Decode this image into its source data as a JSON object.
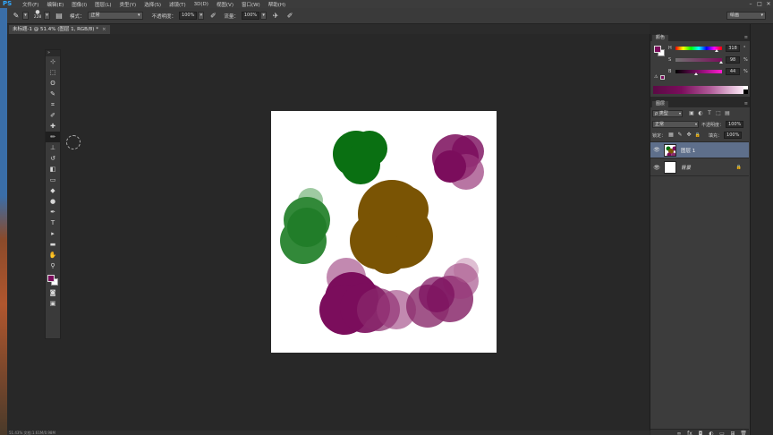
{
  "app": {
    "logo": "PS"
  },
  "menu": [
    "文件(F)",
    "编辑(E)",
    "图像(I)",
    "图层(L)",
    "类型(Y)",
    "选择(S)",
    "滤镜(T)",
    "3D(D)",
    "视图(V)",
    "窗口(W)",
    "帮助(H)"
  ],
  "window_controls": [
    "–",
    "□",
    "✕"
  ],
  "options": {
    "brush_size": "228",
    "mode_label": "模式：",
    "mode_value": "正常",
    "opacity_label": "不透明度：",
    "opacity_value": "100%",
    "flow_label": "流量：",
    "flow_value": "100%",
    "workspace": "绘画"
  },
  "document": {
    "tab_title": "未标题-1 @ 51.4% (图层 1, RGB/8) *",
    "close": "×",
    "status": "51.43%    文档:1.61M/0.98M"
  },
  "tools_panel": {
    "header": "»",
    "tools": [
      {
        "name": "move-tool",
        "glyph": "⊹"
      },
      {
        "name": "marquee-tool",
        "glyph": "⬚"
      },
      {
        "name": "lasso-tool",
        "glyph": "ʘ"
      },
      {
        "name": "quick-select-tool",
        "glyph": "✎"
      },
      {
        "name": "crop-tool",
        "glyph": "⌗"
      },
      {
        "name": "eyedropper-tool",
        "glyph": "✐"
      },
      {
        "name": "healing-brush-tool",
        "glyph": "✚"
      },
      {
        "name": "brush-tool",
        "glyph": "✏"
      },
      {
        "name": "clone-stamp-tool",
        "glyph": "⊥"
      },
      {
        "name": "history-brush-tool",
        "glyph": "↺"
      },
      {
        "name": "eraser-tool",
        "glyph": "◧"
      },
      {
        "name": "gradient-tool",
        "glyph": "▭"
      },
      {
        "name": "blur-tool",
        "glyph": "◆"
      },
      {
        "name": "dodge-tool",
        "glyph": "●"
      },
      {
        "name": "pen-tool",
        "glyph": "✒"
      },
      {
        "name": "type-tool",
        "glyph": "T"
      },
      {
        "name": "path-select-tool",
        "glyph": "▸"
      },
      {
        "name": "shape-tool",
        "glyph": "▬"
      },
      {
        "name": "hand-tool",
        "glyph": "✋"
      },
      {
        "name": "zoom-tool",
        "glyph": "⚲"
      }
    ],
    "quickmask": "◙",
    "screenmode": "▣"
  },
  "color_panel": {
    "tab": "颜色",
    "menu": "≡",
    "foreground": "#7b0d5c",
    "background": "#ffffff",
    "rows": [
      {
        "label": "H",
        "value": "318",
        "unit": "°",
        "level": 0.88
      },
      {
        "label": "S",
        "value": "98",
        "unit": "%",
        "level": 0.98
      },
      {
        "label": "B",
        "value": "44",
        "unit": "%",
        "level": 0.44
      }
    ]
  },
  "layers_panel": {
    "tab": "图层",
    "menu": "≡",
    "filter_kind": "ρ 类型",
    "filter_icons": [
      "▣",
      "◐",
      "T",
      "⬚",
      "▤"
    ],
    "blend_mode": "正常",
    "opacity_label": "不透明度：",
    "opacity_value": "100%",
    "lock_label": "锁定：",
    "lock_icons": [
      "▦",
      "✎",
      "✥",
      "🔒"
    ],
    "fill_label": "填充：",
    "fill_value": "100%",
    "layers": [
      {
        "name": "图层 1",
        "visible": true,
        "selected": true
      },
      {
        "name": "背景",
        "visible": true,
        "selected": false,
        "locked": true
      }
    ],
    "footer_icons": [
      "∞",
      "fx",
      "◘",
      "◐",
      "▭",
      "⊞",
      "🗑"
    ]
  },
  "colors": {
    "green": "#0a7012",
    "green_light": "#2a8a30",
    "brown": "#7a5404",
    "magenta": "#7b0d5c",
    "magenta_light": "#9a3a7c"
  }
}
